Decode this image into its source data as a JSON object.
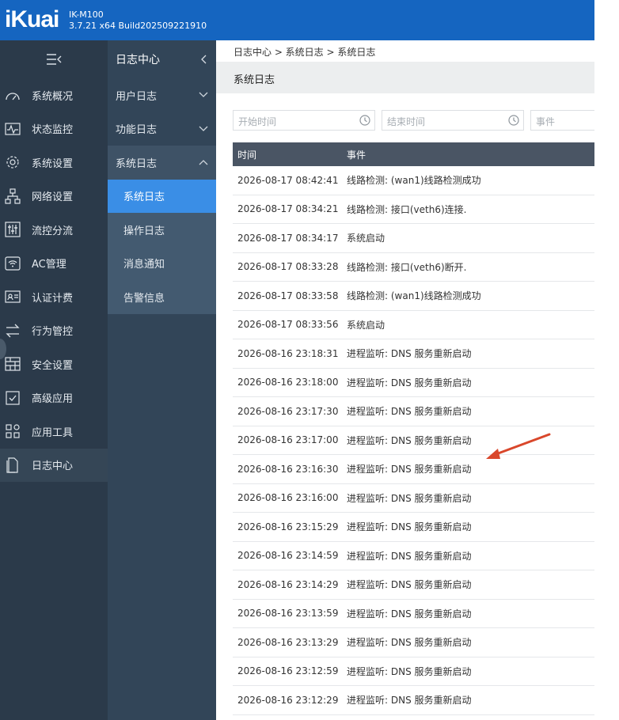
{
  "header": {
    "logo": "iKuai",
    "model": "IK-M100",
    "build": "3.7.21 x64 Build202509221910"
  },
  "nav": {
    "items": [
      {
        "label": "系统概况",
        "icon": "gauge-icon"
      },
      {
        "label": "状态监控",
        "icon": "pulse-icon"
      },
      {
        "label": "系统设置",
        "icon": "gear-icon"
      },
      {
        "label": "网络设置",
        "icon": "network-icon"
      },
      {
        "label": "流控分流",
        "icon": "sliders-icon"
      },
      {
        "label": "AC管理",
        "icon": "wifi-icon"
      },
      {
        "label": "认证计费",
        "icon": "id-card-icon"
      },
      {
        "label": "行为管控",
        "icon": "swap-icon"
      },
      {
        "label": "安全设置",
        "icon": "firewall-icon"
      },
      {
        "label": "高级应用",
        "icon": "check-box-icon"
      },
      {
        "label": "应用工具",
        "icon": "grid-icon"
      },
      {
        "label": "日志中心",
        "icon": "document-icon"
      }
    ],
    "active_index": 11
  },
  "subnav": {
    "title": "日志中心",
    "groups": [
      {
        "label": "用户日志"
      },
      {
        "label": "功能日志"
      },
      {
        "label": "系统日志"
      }
    ],
    "sub_items": [
      {
        "label": "系统日志"
      },
      {
        "label": "操作日志"
      },
      {
        "label": "消息通知"
      },
      {
        "label": "告警信息"
      }
    ]
  },
  "breadcrumb": "日志中心 > 系统日志 > 系统日志",
  "page_title": "系统日志",
  "filters": {
    "start_placeholder": "开始时间",
    "end_placeholder": "结束时间",
    "event_placeholder": "事件"
  },
  "table": {
    "columns": [
      "时间",
      "事件"
    ],
    "rows": [
      {
        "time": "2026-08-17 08:42:41",
        "event": "线路检测: (wan1)线路检测成功"
      },
      {
        "time": "2026-08-17 08:34:21",
        "event": "线路检测: 接口(veth6)连接."
      },
      {
        "time": "2026-08-17 08:34:17",
        "event": "系统启动"
      },
      {
        "time": "2026-08-17 08:33:28",
        "event": "线路检测: 接口(veth6)断开."
      },
      {
        "time": "2026-08-17 08:33:58",
        "event": "线路检测: (wan1)线路检测成功"
      },
      {
        "time": "2026-08-17 08:33:56",
        "event": "系统启动"
      },
      {
        "time": "2026-08-16 23:18:31",
        "event": "进程监听: DNS 服务重新启动"
      },
      {
        "time": "2026-08-16 23:18:00",
        "event": "进程监听: DNS 服务重新启动"
      },
      {
        "time": "2026-08-16 23:17:30",
        "event": "进程监听: DNS 服务重新启动"
      },
      {
        "time": "2026-08-16 23:17:00",
        "event": "进程监听: DNS 服务重新启动"
      },
      {
        "time": "2026-08-16 23:16:30",
        "event": "进程监听: DNS 服务重新启动"
      },
      {
        "time": "2026-08-16 23:16:00",
        "event": "进程监听: DNS 服务重新启动"
      },
      {
        "time": "2026-08-16 23:15:29",
        "event": "进程监听: DNS 服务重新启动"
      },
      {
        "time": "2026-08-16 23:14:59",
        "event": "进程监听: DNS 服务重新启动"
      },
      {
        "time": "2026-08-16 23:14:29",
        "event": "进程监听: DNS 服务重新启动"
      },
      {
        "time": "2026-08-16 23:13:59",
        "event": "进程监听: DNS 服务重新启动"
      },
      {
        "time": "2026-08-16 23:13:29",
        "event": "进程监听: DNS 服务重新启动"
      },
      {
        "time": "2026-08-16 23:12:59",
        "event": "进程监听: DNS 服务重新启动"
      },
      {
        "time": "2026-08-16 23:12:29",
        "event": "进程监听: DNS 服务重新启动"
      }
    ]
  },
  "colors": {
    "header": "#1565c0",
    "nav_bg": "#2b3a4a",
    "subnav_bg": "#324558",
    "active_sub": "#3a8ee6",
    "table_header": "#4a5564",
    "annotation_arrow": "#d9472b"
  }
}
